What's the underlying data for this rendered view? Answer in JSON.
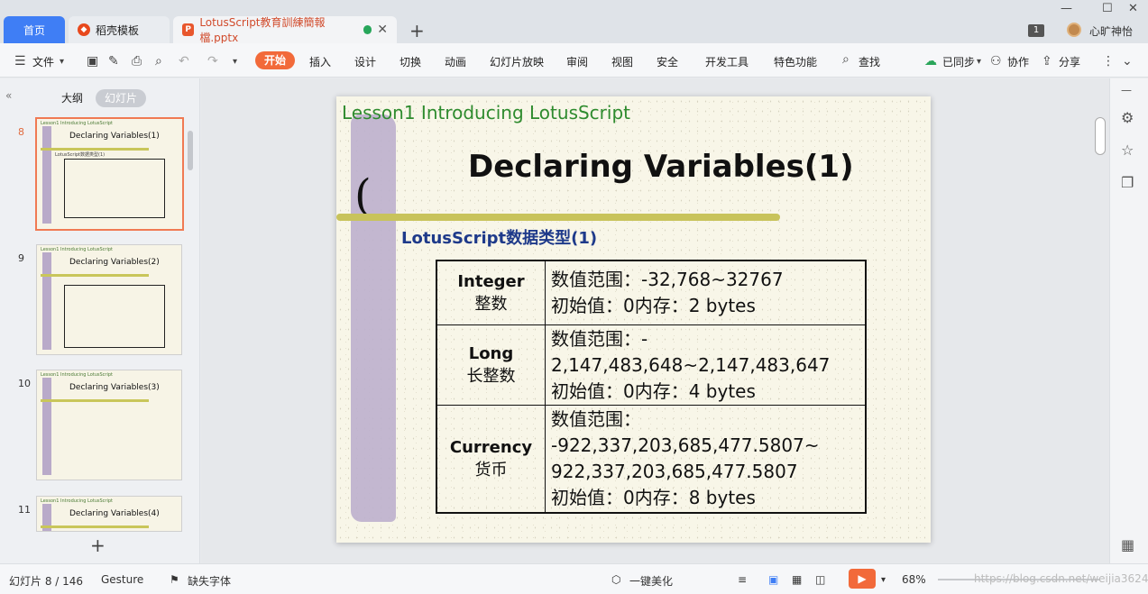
{
  "tabs": {
    "home": "首页",
    "template": "稻壳模板",
    "document": "LotusScript教育訓練簡報檔.pptx"
  },
  "window": {
    "badge": "1",
    "username": "心旷神怡"
  },
  "menu": {
    "file": "文件",
    "start": "开始",
    "insert": "插入",
    "design": "设计",
    "transition": "切换",
    "animation": "动画",
    "slideshow": "幻灯片放映",
    "review": "审阅",
    "view": "视图",
    "security": "安全",
    "devtools": "开发工具",
    "features": "特色功能",
    "find": "查找",
    "sync": "已同步",
    "collab": "协作",
    "share": "分享"
  },
  "leftpanel": {
    "outline_tab": "大纲",
    "slides_tab": "幻灯片",
    "thumbnails": [
      {
        "num": "8",
        "title": "Declaring Variables(1)"
      },
      {
        "num": "9",
        "title": "Declaring Variables(2)"
      },
      {
        "num": "10",
        "title": "Declaring Variables(3)"
      },
      {
        "num": "11",
        "title": "Declaring Variables(4)"
      }
    ]
  },
  "slide": {
    "lesson": "Lesson1 Introducing LotusScript",
    "title": "Declaring Variables(1)",
    "subtitle": "LotusScript数据类型(1)",
    "rows": [
      {
        "type_en": "Integer",
        "type_cn": "整数",
        "lines": [
          "数值范围：-32,768~32767",
          "初始值：0内存：2 bytes"
        ]
      },
      {
        "type_en": "Long",
        "type_cn": "长整数",
        "lines": [
          "数值范围：-",
          "2,147,483,648~2,147,483,647",
          "初始值：0内存：4 bytes"
        ]
      },
      {
        "type_en": "Currency",
        "type_cn": "货币",
        "lines": [
          "数值范围：",
          "-922,337,203,685,477.5807~",
          "922,337,203,685,477.5807",
          "初始值：0内存：8 bytes"
        ]
      }
    ]
  },
  "status": {
    "slide_info": "幻灯片 8 / 146",
    "theme": "Gesture",
    "missing_font": "缺失字体",
    "beautify": "一键美化",
    "zoom": "68%",
    "watermark": "https://blog.csdn.net/weijia3624"
  }
}
